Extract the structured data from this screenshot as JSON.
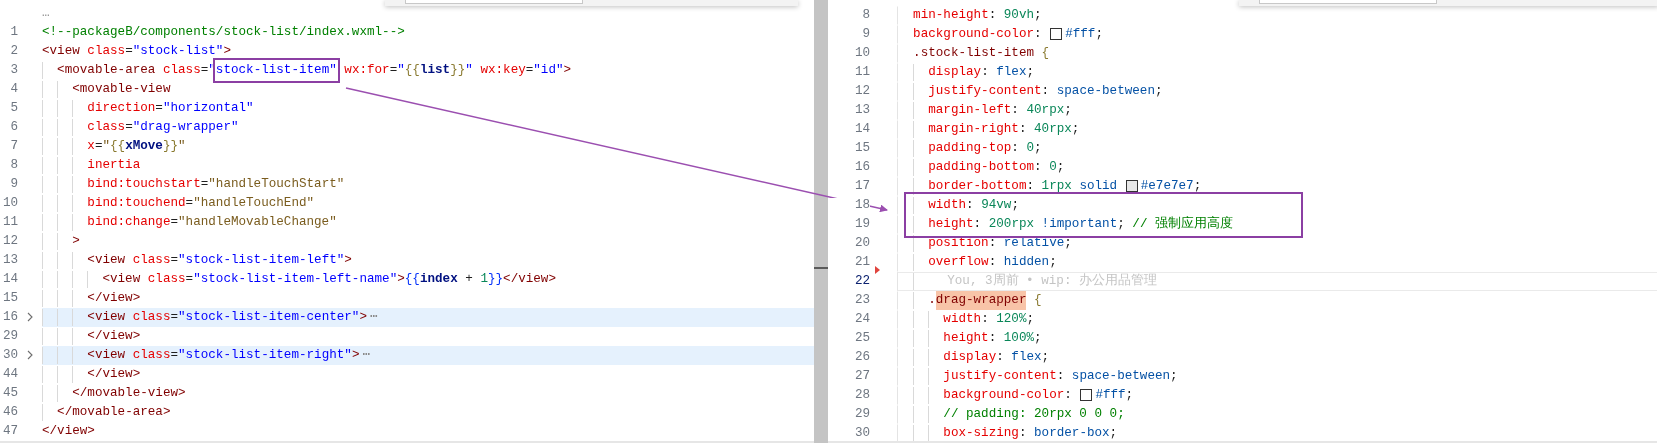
{
  "editors": [
    {
      "top_ellipsis": "…",
      "lines": [
        {
          "number": "1",
          "folded": false,
          "tokens": [
            {
              "kind": "comment",
              "text": "<!--packageB/components/stock-list/index.wxml-->"
            }
          ]
        },
        {
          "number": "2",
          "folded": false,
          "tokens": [
            {
              "kind": "tag",
              "text": "<view"
            },
            {
              "kind": "attr",
              "text": " class"
            },
            {
              "kind": "punct",
              "text": "="
            },
            {
              "kind": "string",
              "text": "\"stock-list\""
            },
            {
              "kind": "tag",
              "text": ">"
            }
          ],
          "children": [
            {
              "number": "3",
              "folded": false,
              "tokens": [
                {
                  "kind": "tag",
                  "text": "<movable-area"
                },
                {
                  "kind": "attr",
                  "text": " class"
                },
                {
                  "kind": "punct",
                  "text": "="
                },
                {
                  "kind": "string",
                  "text": "\""
                },
                {
                  "kind": "string",
                  "text": "stock-list-item\"",
                  "framed": true
                },
                {
                  "kind": "attr",
                  "text": " wx:for"
                },
                {
                  "kind": "punct",
                  "text": "="
                },
                {
                  "kind": "string",
                  "text": "\""
                },
                {
                  "kind": "brace",
                  "text": "{{"
                },
                {
                  "kind": "var",
                  "text": "list"
                },
                {
                  "kind": "brace",
                  "text": "}}"
                },
                {
                  "kind": "string",
                  "text": "\""
                },
                {
                  "kind": "attr",
                  "text": " wx:key"
                },
                {
                  "kind": "punct",
                  "text": "="
                },
                {
                  "kind": "string",
                  "text": "\"id\""
                },
                {
                  "kind": "tag",
                  "text": ">"
                }
              ],
              "children": [
                {
                  "number": "4",
                  "folded": false,
                  "tokens": [
                    {
                      "kind": "tag",
                      "text": "<movable-view"
                    }
                  ],
                  "children": [
                    {
                      "number": "5",
                      "folded": false,
                      "tokens": [
                        {
                          "kind": "attr",
                          "text": "direction"
                        },
                        {
                          "kind": "punct",
                          "text": "="
                        },
                        {
                          "kind": "string",
                          "text": "\"horizontal\""
                        }
                      ]
                    },
                    {
                      "number": "6",
                      "folded": false,
                      "tokens": [
                        {
                          "kind": "attr",
                          "text": "class"
                        },
                        {
                          "kind": "punct",
                          "text": "="
                        },
                        {
                          "kind": "string",
                          "text": "\"drag-wrapper\""
                        }
                      ]
                    },
                    {
                      "number": "7",
                      "folded": false,
                      "tokens": [
                        {
                          "kind": "attr",
                          "text": "x"
                        },
                        {
                          "kind": "punct",
                          "text": "="
                        },
                        {
                          "kind": "handler",
                          "text": "\""
                        },
                        {
                          "kind": "brace",
                          "text": "{{"
                        },
                        {
                          "kind": "var",
                          "text": "xMove"
                        },
                        {
                          "kind": "brace",
                          "text": "}}"
                        },
                        {
                          "kind": "handler",
                          "text": "\""
                        }
                      ]
                    },
                    {
                      "number": "8",
                      "folded": false,
                      "tokens": [
                        {
                          "kind": "attr",
                          "text": "inertia"
                        }
                      ]
                    },
                    {
                      "number": "9",
                      "folded": false,
                      "tokens": [
                        {
                          "kind": "attr",
                          "text": "bind:touchstart"
                        },
                        {
                          "kind": "punct",
                          "text": "="
                        },
                        {
                          "kind": "handler",
                          "text": "\"handleTouchStart\""
                        }
                      ]
                    },
                    {
                      "number": "10",
                      "folded": false,
                      "tokens": [
                        {
                          "kind": "attr",
                          "text": "bind:touchend"
                        },
                        {
                          "kind": "punct",
                          "text": "="
                        },
                        {
                          "kind": "handler",
                          "text": "\"handleTouchEnd\""
                        }
                      ]
                    },
                    {
                      "number": "11",
                      "folded": false,
                      "tokens": [
                        {
                          "kind": "attr",
                          "text": "bind:change"
                        },
                        {
                          "kind": "punct",
                          "text": "="
                        },
                        {
                          "kind": "handler",
                          "text": "\"handleMovableChange\""
                        }
                      ]
                    }
                  ]
                },
                {
                  "number": "12",
                  "folded": false,
                  "tokens": [
                    {
                      "kind": "tag",
                      "text": ">"
                    }
                  ],
                  "children": [
                    {
                      "number": "13",
                      "folded": false,
                      "tokens": [
                        {
                          "kind": "tag",
                          "text": "<view"
                        },
                        {
                          "kind": "attr",
                          "text": " class"
                        },
                        {
                          "kind": "punct",
                          "text": "="
                        },
                        {
                          "kind": "string",
                          "text": "\"stock-list-item-left\""
                        },
                        {
                          "kind": "tag",
                          "text": ">"
                        }
                      ],
                      "children": [
                        {
                          "number": "14",
                          "folded": false,
                          "tokens": [
                            {
                              "kind": "tag",
                              "text": "<view"
                            },
                            {
                              "kind": "attr",
                              "text": " class"
                            },
                            {
                              "kind": "punct",
                              "text": "="
                            },
                            {
                              "kind": "string",
                              "text": "\"stock-list-item-left-name\""
                            },
                            {
                              "kind": "tag",
                              "text": ">"
                            },
                            {
                              "kind": "bracket",
                              "text": "{{"
                            },
                            {
                              "kind": "var",
                              "text": "index"
                            },
                            {
                              "kind": "punct",
                              "text": " + "
                            },
                            {
                              "kind": "number",
                              "text": "1"
                            },
                            {
                              "kind": "bracket",
                              "text": "}}"
                            },
                            {
                              "kind": "tag",
                              "text": "</view>"
                            }
                          ]
                        }
                      ]
                    },
                    {
                      "number": "15",
                      "folded": false,
                      "tokens": [
                        {
                          "kind": "tag",
                          "text": "</view>"
                        }
                      ]
                    },
                    {
                      "number": "16",
                      "folded": true,
                      "tokens": [
                        {
                          "kind": "tag",
                          "text": "<view"
                        },
                        {
                          "kind": "attr",
                          "text": " class"
                        },
                        {
                          "kind": "punct",
                          "text": "="
                        },
                        {
                          "kind": "string",
                          "text": "\"stock-list-item-center\""
                        },
                        {
                          "kind": "tag",
                          "text": ">"
                        },
                        {
                          "kind": "ellipsis",
                          "text": "⋯"
                        }
                      ]
                    },
                    {
                      "number": "29",
                      "folded": false,
                      "tokens": [
                        {
                          "kind": "tag",
                          "text": "</view>"
                        }
                      ]
                    },
                    {
                      "number": "30",
                      "folded": true,
                      "tokens": [
                        {
                          "kind": "tag",
                          "text": "<view"
                        },
                        {
                          "kind": "attr",
                          "text": " class"
                        },
                        {
                          "kind": "punct",
                          "text": "="
                        },
                        {
                          "kind": "string",
                          "text": "\"stock-list-item-right\""
                        },
                        {
                          "kind": "tag",
                          "text": ">"
                        },
                        {
                          "kind": "ellipsis",
                          "text": "⋯"
                        }
                      ]
                    },
                    {
                      "number": "44",
                      "folded": false,
                      "tokens": [
                        {
                          "kind": "tag",
                          "text": "</view>"
                        }
                      ]
                    }
                  ]
                },
                {
                  "number": "45",
                  "folded": false,
                  "tokens": [
                    {
                      "kind": "tag",
                      "text": "</movable-view>"
                    }
                  ]
                }
              ]
            },
            {
              "number": "46",
              "folded": false,
              "tokens": [
                {
                  "kind": "tag",
                  "text": "</movable-area>"
                }
              ]
            }
          ]
        },
        {
          "number": "47",
          "folded": false,
          "tokens": [
            {
              "kind": "tag",
              "text": "</view>"
            }
          ]
        }
      ]
    },
    {
      "lines": [
        {
          "number": "8",
          "current": false,
          "tokens": [
            {
              "kind": "prop",
              "text": "min-height"
            },
            {
              "kind": "punct",
              "text": ": "
            },
            {
              "kind": "number",
              "text": "90vh"
            },
            {
              "kind": "punct",
              "text": ";"
            }
          ]
        },
        {
          "number": "9",
          "current": false,
          "tokens": [
            {
              "kind": "prop",
              "text": "background-color"
            },
            {
              "kind": "punct",
              "text": ": "
            },
            {
              "kind": "swatch",
              "color": "#ffffff"
            },
            {
              "kind": "value",
              "text": "#fff"
            },
            {
              "kind": "punct",
              "text": ";"
            }
          ]
        },
        {
          "number": "10",
          "current": false,
          "tokens": [
            {
              "kind": "selector",
              "text": ".stock-list-item"
            },
            {
              "kind": "brace",
              "text": " {"
            }
          ],
          "children": [
            {
              "number": "11",
              "current": false,
              "tokens": [
                {
                  "kind": "prop",
                  "text": "display"
                },
                {
                  "kind": "punct",
                  "text": ": "
                },
                {
                  "kind": "value",
                  "text": "flex"
                },
                {
                  "kind": "punct",
                  "text": ";"
                }
              ]
            },
            {
              "number": "12",
              "current": false,
              "tokens": [
                {
                  "kind": "prop",
                  "text": "justify-content"
                },
                {
                  "kind": "punct",
                  "text": ": "
                },
                {
                  "kind": "value",
                  "text": "space-between"
                },
                {
                  "kind": "punct",
                  "text": ";"
                }
              ]
            },
            {
              "number": "13",
              "current": false,
              "tokens": [
                {
                  "kind": "prop",
                  "text": "margin-left"
                },
                {
                  "kind": "punct",
                  "text": ": "
                },
                {
                  "kind": "number",
                  "text": "40rpx"
                },
                {
                  "kind": "punct",
                  "text": ";"
                }
              ]
            },
            {
              "number": "14",
              "current": false,
              "tokens": [
                {
                  "kind": "prop",
                  "text": "margin-right"
                },
                {
                  "kind": "punct",
                  "text": ": "
                },
                {
                  "kind": "number",
                  "text": "40rpx"
                },
                {
                  "kind": "punct",
                  "text": ";"
                }
              ]
            },
            {
              "number": "15",
              "current": false,
              "tokens": [
                {
                  "kind": "prop",
                  "text": "padding-top"
                },
                {
                  "kind": "punct",
                  "text": ": "
                },
                {
                  "kind": "number",
                  "text": "0"
                },
                {
                  "kind": "punct",
                  "text": ";"
                }
              ]
            },
            {
              "number": "16",
              "current": false,
              "tokens": [
                {
                  "kind": "prop",
                  "text": "padding-bottom"
                },
                {
                  "kind": "punct",
                  "text": ": "
                },
                {
                  "kind": "number",
                  "text": "0"
                },
                {
                  "kind": "punct",
                  "text": ";"
                }
              ]
            },
            {
              "number": "17",
              "current": false,
              "tokens": [
                {
                  "kind": "prop",
                  "text": "border-bottom"
                },
                {
                  "kind": "punct",
                  "text": ": "
                },
                {
                  "kind": "number",
                  "text": "1rpx"
                },
                {
                  "kind": "value",
                  "text": " solid "
                },
                {
                  "kind": "swatch",
                  "color": "#e7e7e7"
                },
                {
                  "kind": "value",
                  "text": "#e7e7e7"
                },
                {
                  "kind": "punct",
                  "text": ";"
                }
              ]
            },
            {
              "number": "18",
              "current": false,
              "tokens": [
                {
                  "kind": "prop",
                  "text": "width"
                },
                {
                  "kind": "punct",
                  "text": ": "
                },
                {
                  "kind": "number",
                  "text": "94vw"
                },
                {
                  "kind": "punct",
                  "text": ";"
                }
              ]
            },
            {
              "number": "19",
              "current": false,
              "tokens": [
                {
                  "kind": "prop",
                  "text": "height"
                },
                {
                  "kind": "punct",
                  "text": ": "
                },
                {
                  "kind": "number",
                  "text": "200rpx"
                },
                {
                  "kind": "value",
                  "text": " !important"
                },
                {
                  "kind": "punct",
                  "text": "; "
                },
                {
                  "kind": "comment",
                  "text": "// 强制应用高度"
                }
              ]
            },
            {
              "number": "20",
              "current": false,
              "tokens": [
                {
                  "kind": "prop",
                  "text": "position"
                },
                {
                  "kind": "punct",
                  "text": ": "
                },
                {
                  "kind": "value",
                  "text": "relative"
                },
                {
                  "kind": "punct",
                  "text": ";"
                }
              ]
            },
            {
              "number": "21",
              "current": false,
              "tokens": [
                {
                  "kind": "prop",
                  "text": "overflow"
                },
                {
                  "kind": "punct",
                  "text": ": "
                },
                {
                  "kind": "value",
                  "text": "hidden"
                },
                {
                  "kind": "punct",
                  "text": ";"
                }
              ]
            },
            {
              "number": "22",
              "current": true,
              "blame": "You, 3周前 • wip: 办公用品管理"
            },
            {
              "number": "23",
              "current": false,
              "tokens": [
                {
                  "kind": "selector",
                  "text": "."
                },
                {
                  "kind": "selector",
                  "text": "drag-wrapper",
                  "highlighted": true
                },
                {
                  "kind": "brace",
                  "text": " {"
                }
              ],
              "children": [
                {
                  "number": "24",
                  "current": false,
                  "tokens": [
                    {
                      "kind": "prop",
                      "text": "width"
                    },
                    {
                      "kind": "punct",
                      "text": ": "
                    },
                    {
                      "kind": "number",
                      "text": "120%"
                    },
                    {
                      "kind": "punct",
                      "text": ";"
                    }
                  ]
                },
                {
                  "number": "25",
                  "current": false,
                  "tokens": [
                    {
                      "kind": "prop",
                      "text": "height"
                    },
                    {
                      "kind": "punct",
                      "text": ": "
                    },
                    {
                      "kind": "number",
                      "text": "100%"
                    },
                    {
                      "kind": "punct",
                      "text": ";"
                    }
                  ]
                },
                {
                  "number": "26",
                  "current": false,
                  "tokens": [
                    {
                      "kind": "prop",
                      "text": "display"
                    },
                    {
                      "kind": "punct",
                      "text": ": "
                    },
                    {
                      "kind": "value",
                      "text": "flex"
                    },
                    {
                      "kind": "punct",
                      "text": ";"
                    }
                  ]
                },
                {
                  "number": "27",
                  "current": false,
                  "tokens": [
                    {
                      "kind": "prop",
                      "text": "justify-content"
                    },
                    {
                      "kind": "punct",
                      "text": ": "
                    },
                    {
                      "kind": "value",
                      "text": "space-between"
                    },
                    {
                      "kind": "punct",
                      "text": ";"
                    }
                  ]
                },
                {
                  "number": "28",
                  "current": false,
                  "tokens": [
                    {
                      "kind": "prop",
                      "text": "background-color"
                    },
                    {
                      "kind": "punct",
                      "text": ": "
                    },
                    {
                      "kind": "swatch",
                      "color": "#ffffff"
                    },
                    {
                      "kind": "value",
                      "text": "#fff"
                    },
                    {
                      "kind": "punct",
                      "text": ";"
                    }
                  ]
                },
                {
                  "number": "29",
                  "current": false,
                  "tokens": [
                    {
                      "kind": "comment",
                      "text": "// padding: 20rpx 0 0 0;"
                    }
                  ]
                },
                {
                  "number": "30",
                  "current": false,
                  "tokens": [
                    {
                      "kind": "prop",
                      "text": "box-sizing"
                    },
                    {
                      "kind": "punct",
                      "text": ": "
                    },
                    {
                      "kind": "value",
                      "text": "border-box"
                    },
                    {
                      "kind": "punct",
                      "text": ";"
                    }
                  ]
                }
              ]
            }
          ]
        }
      ]
    }
  ]
}
